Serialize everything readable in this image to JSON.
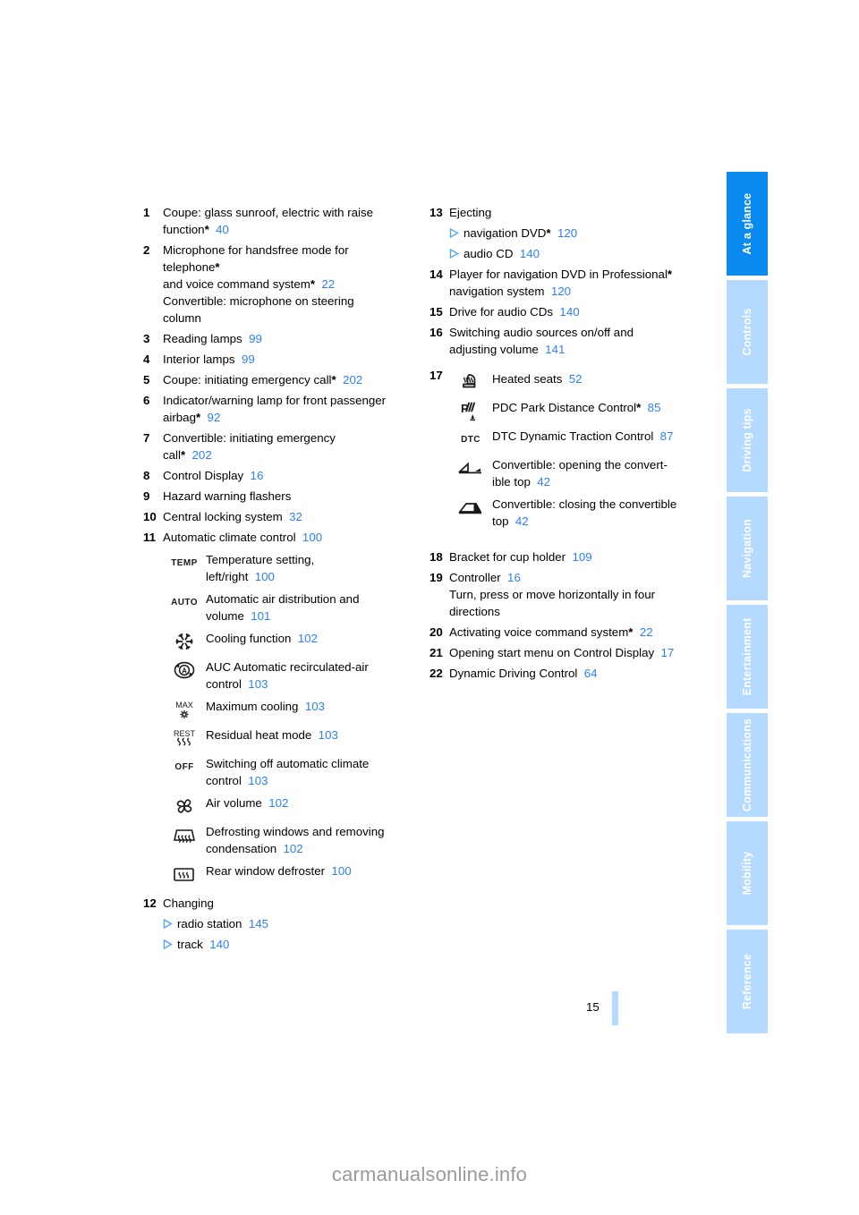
{
  "sidebar": {
    "tabs": [
      {
        "label": "At a glance",
        "active": true
      },
      {
        "label": "Controls",
        "active": false
      },
      {
        "label": "Driving tips",
        "active": false
      },
      {
        "label": "Navigation",
        "active": false
      },
      {
        "label": "Entertainment",
        "active": false
      },
      {
        "label": "Communications",
        "active": false
      },
      {
        "label": "Mobility",
        "active": false
      },
      {
        "label": "Reference",
        "active": false
      }
    ],
    "active_color": "#0b8af0",
    "inactive_color": "#b5daff"
  },
  "footer": {
    "page_number": "15",
    "watermark": "carmanualsonline.info"
  },
  "colors": {
    "page_ref_blue": "#2b7fff",
    "accent_blue": "#0b8af0",
    "light_blue": "#b5daff"
  },
  "left_column": {
    "items": [
      {
        "num": "1",
        "lines": [
          {
            "text": "Coupe: glass sunroof, electric with raise"
          },
          {
            "text": "function",
            "star": "*",
            "page": "40"
          }
        ]
      },
      {
        "num": "2",
        "lines": [
          {
            "text": "Microphone for handsfree mode for"
          },
          {
            "text": "telephone",
            "star": "*"
          },
          {
            "text": "and voice command system",
            "star": "*",
            "page": "22"
          },
          {
            "text": "Convertible: microphone on steering"
          },
          {
            "text": "column"
          }
        ]
      },
      {
        "num": "3",
        "lines": [
          {
            "text": "Reading lamps",
            "page": "99"
          }
        ]
      },
      {
        "num": "4",
        "lines": [
          {
            "text": "Interior lamps",
            "page": "99"
          }
        ]
      },
      {
        "num": "5",
        "lines": [
          {
            "text": "Coupe: initiating emergency call",
            "star": "*",
            "page": "202"
          }
        ]
      },
      {
        "num": "6",
        "lines": [
          {
            "text": "Indicator/warning lamp for front passenger"
          },
          {
            "text": "airbag",
            "star": "*",
            "page": "92"
          }
        ]
      },
      {
        "num": "7",
        "lines": [
          {
            "text": "Convertible: initiating emergency"
          },
          {
            "text": "call",
            "star": "*",
            "page": "202"
          }
        ]
      },
      {
        "num": "8",
        "lines": [
          {
            "text": "Control Display",
            "page": "16"
          }
        ]
      },
      {
        "num": "9",
        "lines": [
          {
            "text": "Hazard warning flashers"
          }
        ]
      },
      {
        "num": "10",
        "lines": [
          {
            "text": "Central locking system",
            "page": "32"
          }
        ]
      },
      {
        "num": "11",
        "lines": [
          {
            "text": "Automatic climate control",
            "page": "100"
          }
        ]
      }
    ],
    "climate_icons": [
      {
        "icon": "temp-icon",
        "glyph_top": "TEMP",
        "glyph_bottom": "",
        "lines": [
          {
            "text": "Temperature setting,"
          },
          {
            "text": "left/right",
            "page": "100"
          }
        ]
      },
      {
        "icon": "auto-icon",
        "glyph_top": "AUTO",
        "glyph_bottom": "",
        "lines": [
          {
            "text": "Automatic air distribution and"
          },
          {
            "text": "volume",
            "page": "101"
          }
        ]
      },
      {
        "icon": "snowflake-icon",
        "glyph_top": "",
        "glyph_bottom": "",
        "lines": [
          {
            "text": "Cooling function",
            "page": "102"
          }
        ]
      },
      {
        "icon": "recirculated-air-icon",
        "glyph_top": "",
        "glyph_bottom": "",
        "lines": [
          {
            "text": "AUC Automatic recirculated-air"
          },
          {
            "text": "control",
            "page": "103"
          }
        ]
      },
      {
        "icon": "max-cooling-icon",
        "glyph_top": "MAX",
        "glyph_bottom": "",
        "lines": [
          {
            "text": "Maximum cooling",
            "page": "103"
          }
        ]
      },
      {
        "icon": "residual-heat-icon",
        "glyph_top": "REST",
        "glyph_bottom": "",
        "lines": [
          {
            "text": "Residual heat mode",
            "page": "103"
          }
        ]
      },
      {
        "icon": "off-icon",
        "glyph_top": "OFF",
        "glyph_bottom": "",
        "lines": [
          {
            "text": "Switching off automatic climate"
          },
          {
            "text": "control",
            "page": "103"
          }
        ]
      },
      {
        "icon": "fan-icon",
        "glyph_top": "",
        "glyph_bottom": "",
        "lines": [
          {
            "text": "Air volume",
            "page": "102"
          }
        ]
      },
      {
        "icon": "windshield-defrost-icon",
        "glyph_top": "",
        "glyph_bottom": "",
        "lines": [
          {
            "text": "Defrosting windows and removing"
          },
          {
            "text": "condensation",
            "page": "102"
          }
        ]
      },
      {
        "icon": "rear-defroster-icon",
        "glyph_top": "",
        "glyph_bottom": "",
        "lines": [
          {
            "text": "Rear window defroster",
            "page": "100"
          }
        ]
      }
    ],
    "item12": {
      "num": "12",
      "label": "Changing",
      "bullets": [
        {
          "text": "radio station",
          "page": "145"
        },
        {
          "text": "track",
          "page": "140"
        }
      ]
    }
  },
  "right_column": {
    "item13": {
      "num": "13",
      "label": "Ejecting",
      "bullets": [
        {
          "text": "navigation DVD",
          "star": "*",
          "page": "120"
        },
        {
          "text": "audio CD",
          "page": "140"
        }
      ]
    },
    "items_mid": [
      {
        "num": "14",
        "lines": [
          {
            "text": "Player for navigation DVD in Professional",
            "star": "*"
          },
          {
            "text": "navigation system",
            "page": "120"
          }
        ]
      },
      {
        "num": "15",
        "lines": [
          {
            "text": "Drive for audio CDs",
            "page": "140"
          }
        ]
      },
      {
        "num": "16",
        "lines": [
          {
            "text": "Switching audio sources on/off and"
          },
          {
            "text": "adjusting volume",
            "page": "141"
          }
        ]
      }
    ],
    "item17": {
      "num": "17",
      "icons": [
        {
          "icon": "heated-seat-icon",
          "glyph": "",
          "lines": [
            {
              "text": "Heated seats",
              "page": "52"
            }
          ]
        },
        {
          "icon": "pdc-icon",
          "glyph": "",
          "lines": [
            {
              "text": "PDC Park Distance Control",
              "star": "*",
              "page": "85"
            }
          ]
        },
        {
          "icon": "dtc-icon",
          "glyph": "DTC",
          "lines": [
            {
              "text": "DTC Dynamic Traction Control",
              "page": "87"
            }
          ]
        },
        {
          "icon": "convertible-top-open-icon",
          "glyph": "",
          "lines": [
            {
              "text": "Convertible: opening the convert-"
            },
            {
              "text": "ible top",
              "page": "42"
            }
          ]
        },
        {
          "icon": "convertible-top-close-icon",
          "glyph": "",
          "lines": [
            {
              "text": "Convertible: closing the convertible"
            },
            {
              "text": "top",
              "page": "42"
            }
          ]
        }
      ]
    },
    "items_end": [
      {
        "num": "18",
        "lines": [
          {
            "text": "Bracket for cup holder",
            "page": "109"
          }
        ]
      },
      {
        "num": "19",
        "lines": [
          {
            "text": "Controller",
            "page": "16"
          },
          {
            "text": "Turn, press or move horizontally in four"
          },
          {
            "text": "directions"
          }
        ]
      },
      {
        "num": "20",
        "lines": [
          {
            "text": "Activating voice command system",
            "star": "*",
            "page": "22"
          }
        ]
      },
      {
        "num": "21",
        "lines": [
          {
            "text": "Opening start menu on Control Display",
            "page": "17"
          }
        ]
      },
      {
        "num": "22",
        "lines": [
          {
            "text": "Dynamic Driving Control",
            "page": "64"
          }
        ]
      }
    ]
  }
}
